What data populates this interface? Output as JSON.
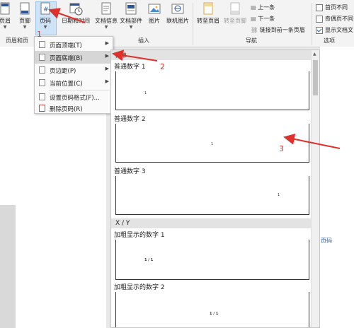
{
  "ribbon": {
    "buttons": {
      "header": "页眉",
      "footer": "页脚",
      "page_number": "页码",
      "datetime": "日期和时间",
      "docinfo": "文档信息",
      "docparts": "文档部件",
      "picture": "图片",
      "online_picture": "联机图片",
      "goto_header": "转至页眉",
      "goto_footer": "转至页脚"
    },
    "nav": {
      "prev": "上一条",
      "next": "下一条",
      "link_prev": "链接到前一条页眉"
    },
    "options": {
      "first_page": "首页不同",
      "odd_even": "奇偶页不同",
      "show_doc_text": "显示文档文"
    },
    "groups": {
      "header_footer": "页眉和页",
      "insert": "插入",
      "navigation": "导航",
      "options": "选项"
    }
  },
  "menu": {
    "items": [
      {
        "label": "页面顶端(T)"
      },
      {
        "label": "页面底端(B)"
      },
      {
        "label": "页边距(P)"
      },
      {
        "label": "当前位置(C)"
      },
      {
        "label": "设置页码格式(F)..."
      },
      {
        "label": "删除页码(R)"
      }
    ]
  },
  "gallery": {
    "header": "简单",
    "items": [
      {
        "title": "普通数字 1",
        "num": "1"
      },
      {
        "title": "普通数字 2",
        "num": "1"
      },
      {
        "title": "普通数字 3",
        "num": "1"
      }
    ],
    "category": "X / Y",
    "bold_items": [
      {
        "title": "加粗显示的数字 1",
        "num": "1 / 1"
      },
      {
        "title": "加粗显示的数字 2",
        "num": "1 / 1"
      }
    ]
  },
  "side_link": "页码",
  "annotations": [
    "1",
    "2",
    "3"
  ],
  "colors": {
    "accent": "#2b579a",
    "annotation": "#e0302c",
    "menu_active": "#d6d6d6"
  }
}
